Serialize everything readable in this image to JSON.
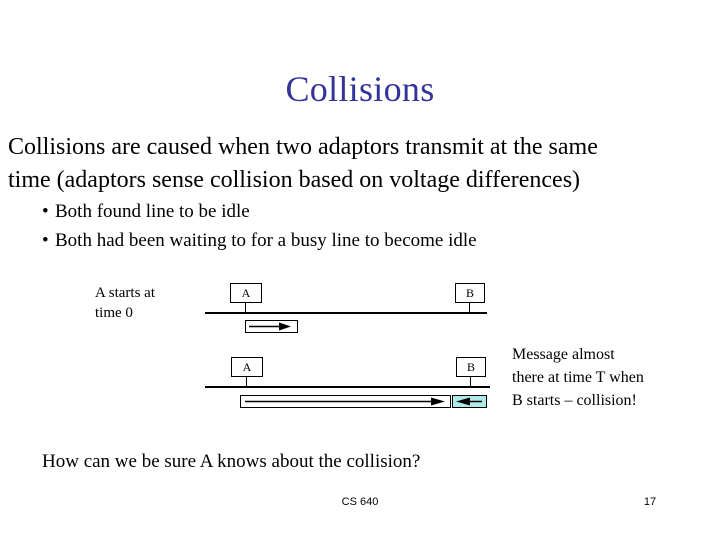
{
  "slide": {
    "title": "Collisions",
    "title_color": "#333399",
    "background_color": "#ffffff",
    "text_color": "#000000"
  },
  "body": {
    "line1": "Collisions are caused when two adaptors transmit at the same",
    "line2": "time (adaptors sense collision based on voltage differences)",
    "bullet_char": "•",
    "bullets": [
      "Both found line to be idle",
      "Both had been waiting to for a busy line to become idle"
    ]
  },
  "diagram": {
    "left_label_line1": "A starts at",
    "left_label_line2": "time 0",
    "row1": {
      "node_a_label": "A",
      "node_b_label": "B",
      "packet_direction": "right"
    },
    "row2": {
      "node_a_label": "A",
      "node_b_label": "B",
      "packet_direction": "right",
      "collision_packet_direction": "left",
      "collision_packet_color": "#aeeaea"
    },
    "note": {
      "line1": "Message almost",
      "line2": "there at time T when",
      "line3": "B starts – collision!"
    }
  },
  "question": "How can we be sure A knows about the collision?",
  "footer": {
    "course": "CS 640",
    "page_number": "17"
  }
}
